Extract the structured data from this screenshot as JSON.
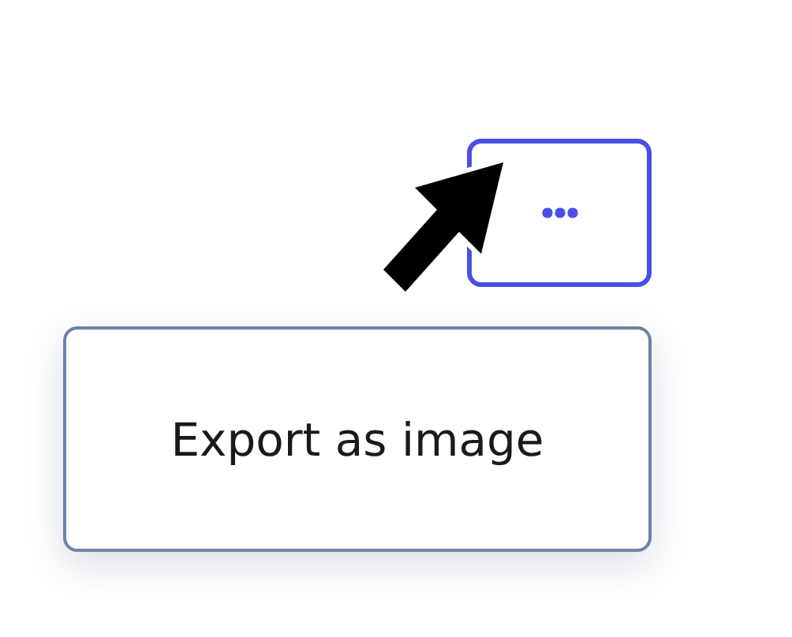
{
  "more_button": {
    "focused": true
  },
  "menu": {
    "items": [
      {
        "label": "Export as image"
      }
    ]
  }
}
